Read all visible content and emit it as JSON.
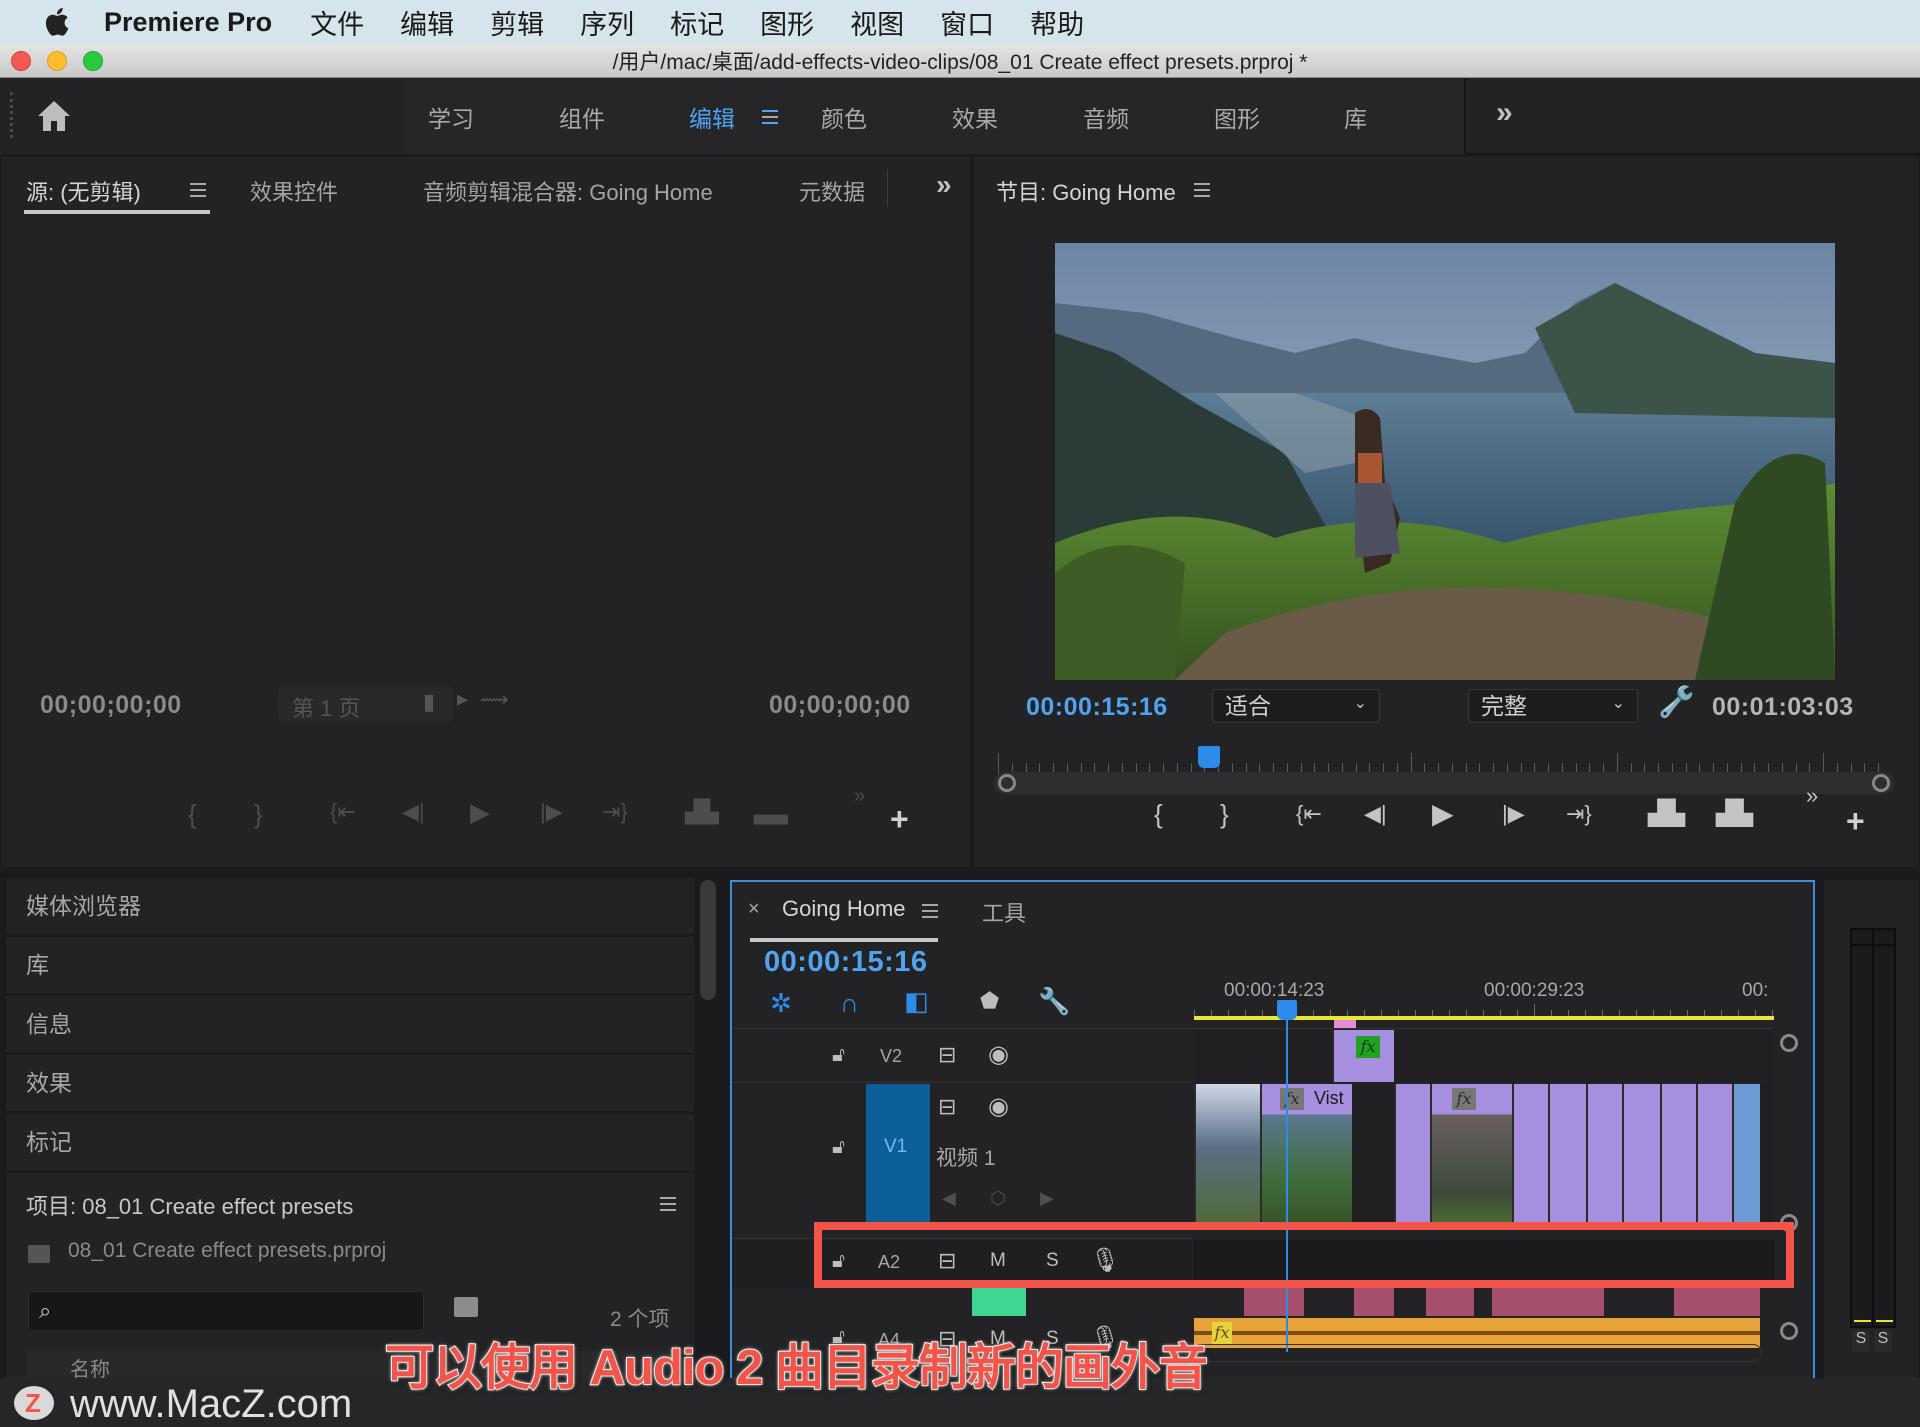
{
  "menubar": {
    "app_name": "Premiere Pro",
    "items": [
      "文件",
      "编辑",
      "剪辑",
      "序列",
      "标记",
      "图形",
      "视图",
      "窗口",
      "帮助"
    ]
  },
  "window": {
    "title": "/用户/mac/桌面/add-effects-video-clips/08_01 Create effect presets.prproj *"
  },
  "workspaces": {
    "items": [
      "学习",
      "组件",
      "编辑",
      "颜色",
      "效果",
      "音频",
      "图形",
      "库"
    ],
    "active": "编辑",
    "overflow": "»"
  },
  "source_panel": {
    "tabs": [
      "源: (无剪辑)",
      "效果控件",
      "音频剪辑混合器: Going Home",
      "元数据"
    ],
    "overflow": "»",
    "timecode_left": "00;00;00;00",
    "timecode_right": "00;00;00;00",
    "page_label": "第 1 页"
  },
  "program_panel": {
    "tab": "节目: Going Home",
    "current_timecode": "00:00:15:16",
    "zoom_select": "适合",
    "quality_select": "完整",
    "duration": "00:01:03:03",
    "playhead_fraction": 0.24,
    "overflow": "»"
  },
  "left_panels": {
    "items": [
      "媒体浏览器",
      "库",
      "信息",
      "效果",
      "标记"
    ],
    "project_title": "项目: 08_01 Create effect presets",
    "project_file": "08_01 Create effect presets.prproj",
    "search_placeholder": "",
    "item_count": "2 个项",
    "name_column": "名称"
  },
  "timeline": {
    "tab": "Going Home",
    "tools_tab": "工具",
    "timecode": "00:00:15:16",
    "ruler_labels": [
      "00:00:14:23",
      "00:00:29:23",
      "00:"
    ],
    "tracks": {
      "v2": "V2",
      "v1": "V1",
      "v1_name": "视频 1",
      "a2": "A2",
      "a4": "A4",
      "mute": "M",
      "solo": "S"
    },
    "clip_label": "Vist",
    "fx": "fx"
  },
  "meter": {
    "solo_left": "S",
    "solo_right": "S"
  },
  "caption": "可以使用 Audio 2 曲目录制新的画外音",
  "watermark": "www.MacZ.com",
  "colors": {
    "accent_blue": "#4fa3f0",
    "clip_purple": "#a78fe0",
    "audio_orange": "#e7a23a",
    "audio_pink": "#a6506e",
    "highlight_red": "#f25449",
    "work_area_yellow": "#e8e832"
  }
}
